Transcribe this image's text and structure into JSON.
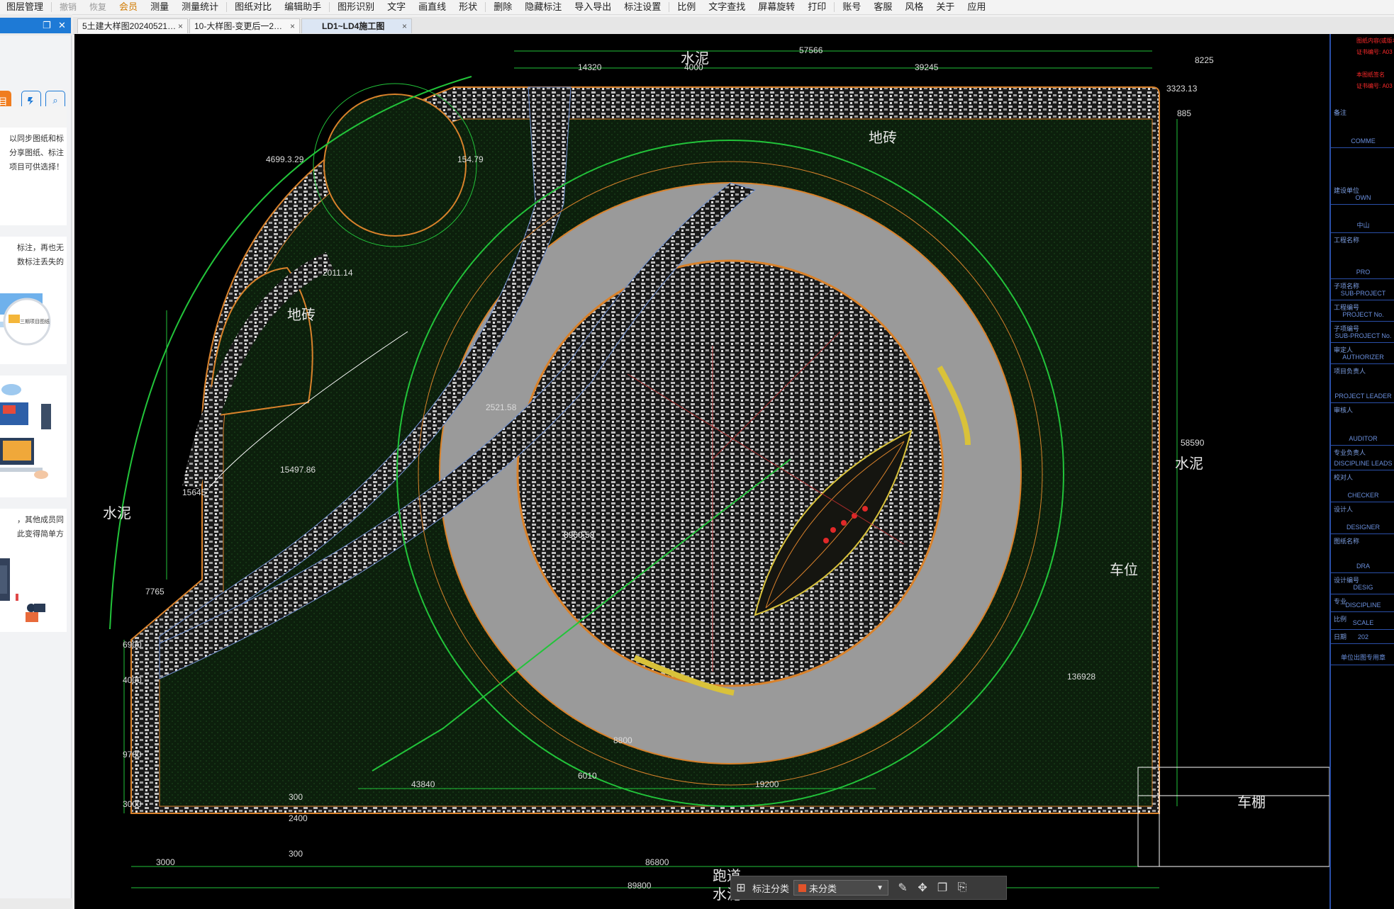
{
  "menu": [
    "图层管理",
    "撤销",
    "恢复",
    "会员",
    "测量",
    "测量统计",
    "图纸对比",
    "编辑助手",
    "图形识别",
    "文字",
    "画直线",
    "形状",
    "删除",
    "隐藏标注",
    "导入导出",
    "标注设置",
    "比例",
    "文字查找",
    "屏幕旋转",
    "打印",
    "账号",
    "客服",
    "风格",
    "关于",
    "应用"
  ],
  "tabs": [
    {
      "label": "5土建大样图20240521…",
      "close": "×"
    },
    {
      "label": "10-大样图-变更后一2…",
      "close": "×"
    },
    {
      "label": "LD1~LD4施工图",
      "close": "×"
    }
  ],
  "sidebar": {
    "head_restore_icon": "❐",
    "head_close_icon": "✕",
    "cut_label": "目",
    "sync_icon": "sync-icon",
    "search_icon": "⌕",
    "card1": [
      "以同步图纸和标",
      "分享图纸、标注",
      "项目可供选择！"
    ],
    "card2": [
      "标注，再也无",
      "数标注丢失的"
    ],
    "card2_folder": "三期项目图纸",
    "card4": [
      "，其他成员同",
      "此变得简单方"
    ]
  },
  "drawing": {
    "dims": [
      "57566",
      "14320",
      "4000",
      "39245",
      "3323.13",
      "8225",
      "885",
      "58590",
      "136928",
      "19200",
      "43840",
      "86800",
      "89800",
      "3000",
      "6900",
      "4000",
      "9780",
      "3000",
      "300",
      "2400",
      "300",
      "15645",
      "7765",
      "4699.3.29",
      "15497.86",
      "8800",
      "6010",
      "8960.58",
      "2011.14",
      "154.79",
      "2521.58"
    ],
    "labels": [
      "水泥",
      "地砖",
      "地砖",
      "水泥",
      "水泥",
      "车位",
      "车棚",
      "跑道",
      "水泥",
      "地砖"
    ]
  },
  "titleblock": {
    "red_lines": [
      "图纸内容(或版本",
      "证书编号: A03",
      "本图纸签名",
      "证书编号: A03"
    ],
    "rows": [
      {
        "k": "备注",
        "v": "COMME"
      },
      {
        "k": "建设单位",
        "v": "OWN"
      },
      {
        "k": "",
        "v": "中山"
      },
      {
        "k": "工程名称",
        "v": "PRO"
      },
      {
        "k": "子项名称",
        "v": "SUB-PROJECT"
      },
      {
        "k": "工程编号",
        "v": "PROJECT No."
      },
      {
        "k": "子项编号",
        "v": "SUB-PROJECT No."
      },
      {
        "k": "审定人",
        "v": "AUTHORIZER"
      },
      {
        "k": "项目负责人",
        "v": "PROJECT LEADER"
      },
      {
        "k": "审核人",
        "v": "AUDITOR"
      },
      {
        "k": "专业负责人",
        "v": "DISCIPLINE LEADS"
      },
      {
        "k": "校对人",
        "v": "CHECKER"
      },
      {
        "k": "设计人",
        "v": "DESIGNER"
      },
      {
        "k": "图纸名称",
        "v": "DRA"
      },
      {
        "k": "设计编号",
        "v": "DESIG"
      },
      {
        "k": "专业",
        "v": "DISCIPLINE"
      },
      {
        "k": "比例",
        "v": "SCALE"
      },
      {
        "k": "日期",
        "v": "202"
      },
      {
        "k": "",
        "v": "单位出图专用章"
      }
    ]
  },
  "bottom": {
    "label": "标注分类",
    "select_value": "未分类",
    "select_color": "#e0532a"
  },
  "colors": {
    "canvas_bg": "#000000",
    "accent": "#1e7ad6",
    "green_line": "#22c43a",
    "orange_line": "#d9822b",
    "gray_ring": "#9a9a9a"
  }
}
